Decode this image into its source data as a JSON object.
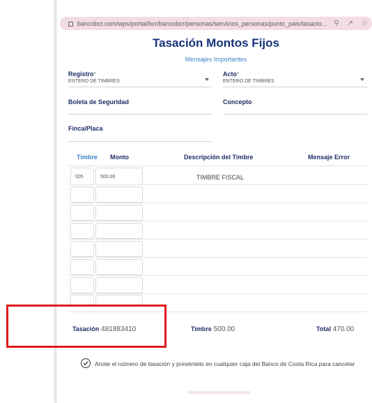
{
  "browser": {
    "url": "bancobcr.com/wps/portal/bcr/bancobcr/personas/servicios_personas/punto_pais/tasacio..."
  },
  "page": {
    "title": "Tasación Montos Fijos",
    "subtitle": "Mensajes Importantes"
  },
  "form": {
    "registro": {
      "label": "Registro",
      "required_mark": "*",
      "value": "ENTERO DE TIMBRES"
    },
    "acto": {
      "label": "Acto",
      "required_mark": "*",
      "value": "ENTERO DE TIMBRES"
    },
    "boleta": {
      "label": "Boleta de Seguridad"
    },
    "concepto": {
      "label": "Concepto"
    },
    "finca": {
      "label": "Finca/Placa"
    }
  },
  "table": {
    "headers": [
      "Timbre",
      "Monto",
      "Descripción del Timbre",
      "Mensaje Error"
    ],
    "rows": [
      {
        "timbre": "005",
        "monto": "500.00",
        "descripcion": "TIMBRE FISCAL"
      }
    ],
    "empty_rows": 7
  },
  "summary": {
    "tasacion_label": "Tasación",
    "tasacion_value": "481883410",
    "timbre_label": "Timbre",
    "timbre_value": "500.00",
    "total_label": "Total",
    "total_value": "470.00"
  },
  "footer": {
    "note": "Anote el número de tasación y preséntelo en cualquier caja del Banco de Costa Rica para cancelar"
  },
  "colors": {
    "title": "#15327a",
    "link": "#3d82c9",
    "highlight": "#e01c1c",
    "urlbar": "#f3dde3"
  }
}
